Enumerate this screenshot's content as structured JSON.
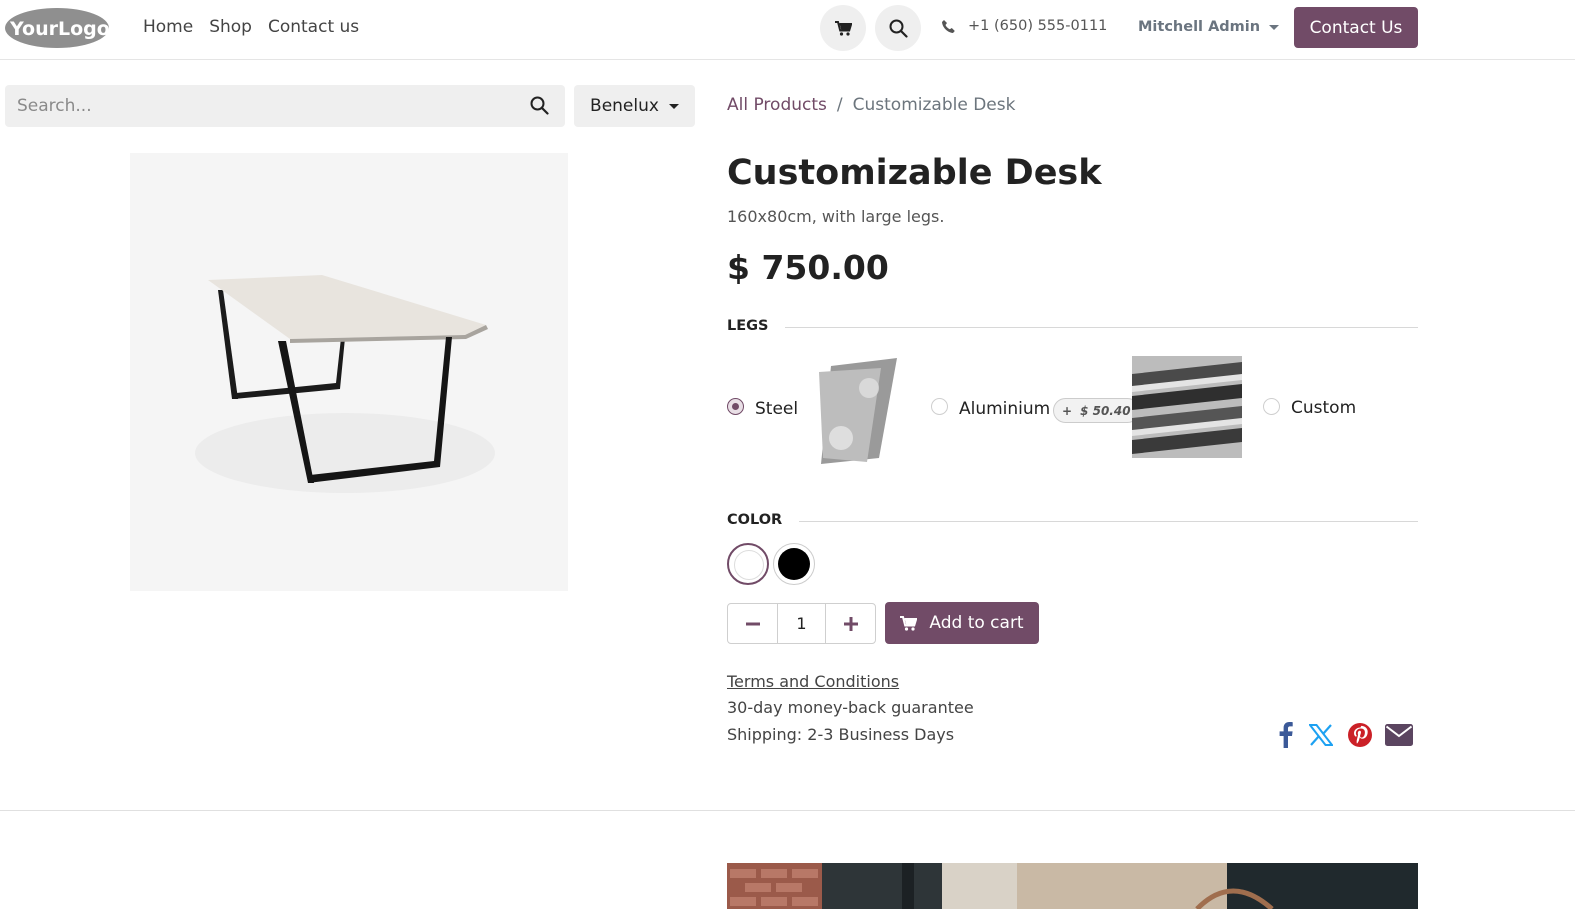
{
  "header": {
    "logo_text": "YourLogo",
    "nav": [
      "Home",
      "Shop",
      "Contact us"
    ],
    "phone": "+1 (650) 555-0111",
    "user": "Mitchell Admin",
    "contact_button": "Contact Us"
  },
  "search": {
    "placeholder": "Search..."
  },
  "pricelist": {
    "selected": "Benelux"
  },
  "breadcrumb": {
    "parent": "All Products",
    "separator": "/",
    "current": "Customizable Desk"
  },
  "product": {
    "name": "Customizable Desk",
    "description": "160x80cm, with large legs.",
    "price": "$ 750.00"
  },
  "attributes": {
    "legs": {
      "label": "LEGS",
      "options": [
        {
          "label": "Steel",
          "selected": true
        },
        {
          "label": "Aluminium",
          "selected": false,
          "extra_sign": "+",
          "extra_price": "$ 50.40"
        },
        {
          "label": "Custom",
          "selected": false
        }
      ]
    },
    "color": {
      "label": "COLOR",
      "options": [
        {
          "name": "White",
          "hex": "#ffffff",
          "selected": true
        },
        {
          "name": "Black",
          "hex": "#000000",
          "selected": false
        }
      ]
    }
  },
  "cart": {
    "quantity": "1",
    "add_label": "Add to cart"
  },
  "info": {
    "terms": "Terms and Conditions",
    "guarantee": "30-day money-back guarantee",
    "shipping": "Shipping: 2-3 Business Days"
  },
  "share_icons": [
    "facebook-icon",
    "x-twitter-icon",
    "pinterest-icon",
    "email-icon"
  ],
  "colors": {
    "brand": "#714b67",
    "facebook": "#3b5998",
    "twitter": "#1da1f2",
    "pinterest": "#cb2027",
    "email": "#5b4560"
  }
}
